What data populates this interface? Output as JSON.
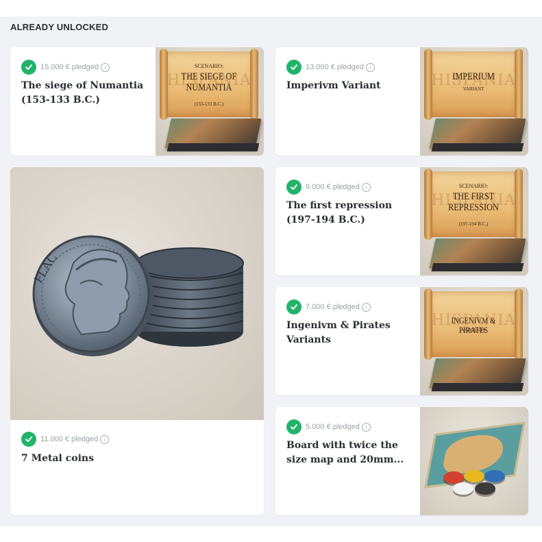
{
  "section": {
    "title": "ALREADY UNLOCKED"
  },
  "cards": [
    {
      "pledge": "15.000 € pledged",
      "title": "The siege of Numantia (153-133 B.C.)",
      "art": {
        "small": "SCENARIO:",
        "big": "THE SIEGE OF NUMANTIA",
        "sub": "(153-133 B.C.)",
        "watermark": "HISPANIA"
      }
    },
    {
      "pledge": "13.000 € pledged",
      "title": "Imperivm Variant",
      "art": {
        "small": "",
        "big": "IMPERIUM",
        "sub": "VARIANT",
        "watermark": "HISPANIA"
      }
    },
    {
      "pledge": "11.000 € pledged",
      "title": "7 Metal coins",
      "art": {
        "coin_text": "FLAC"
      }
    },
    {
      "pledge": "9.000 € pledged",
      "title": "The first repression (197-194 B.C.)",
      "art": {
        "small": "SCENARIO:",
        "big": "THE FIRST REPRESSION",
        "sub": "(197-194 B.C.)",
        "watermark": "HISPANIA"
      }
    },
    {
      "pledge": "7.000 € pledged",
      "title": "Ingenivm & Pirates Variants",
      "art": {
        "small": "",
        "big": "INGENIVM & PIRATES",
        "sub": "VARIANTS",
        "watermark": "HISPANIA"
      }
    },
    {
      "pledge": "5.000 € pledged",
      "title": "Board with twice the size map and 20mm...",
      "art": {}
    }
  ],
  "icons": {
    "check": "check-icon",
    "info": "info-icon"
  },
  "colors": {
    "check_green": "#22b36b",
    "section_bg": "#f1f2f6",
    "title_text": "#2a2d32",
    "pledge_text": "#9aa0a8"
  }
}
